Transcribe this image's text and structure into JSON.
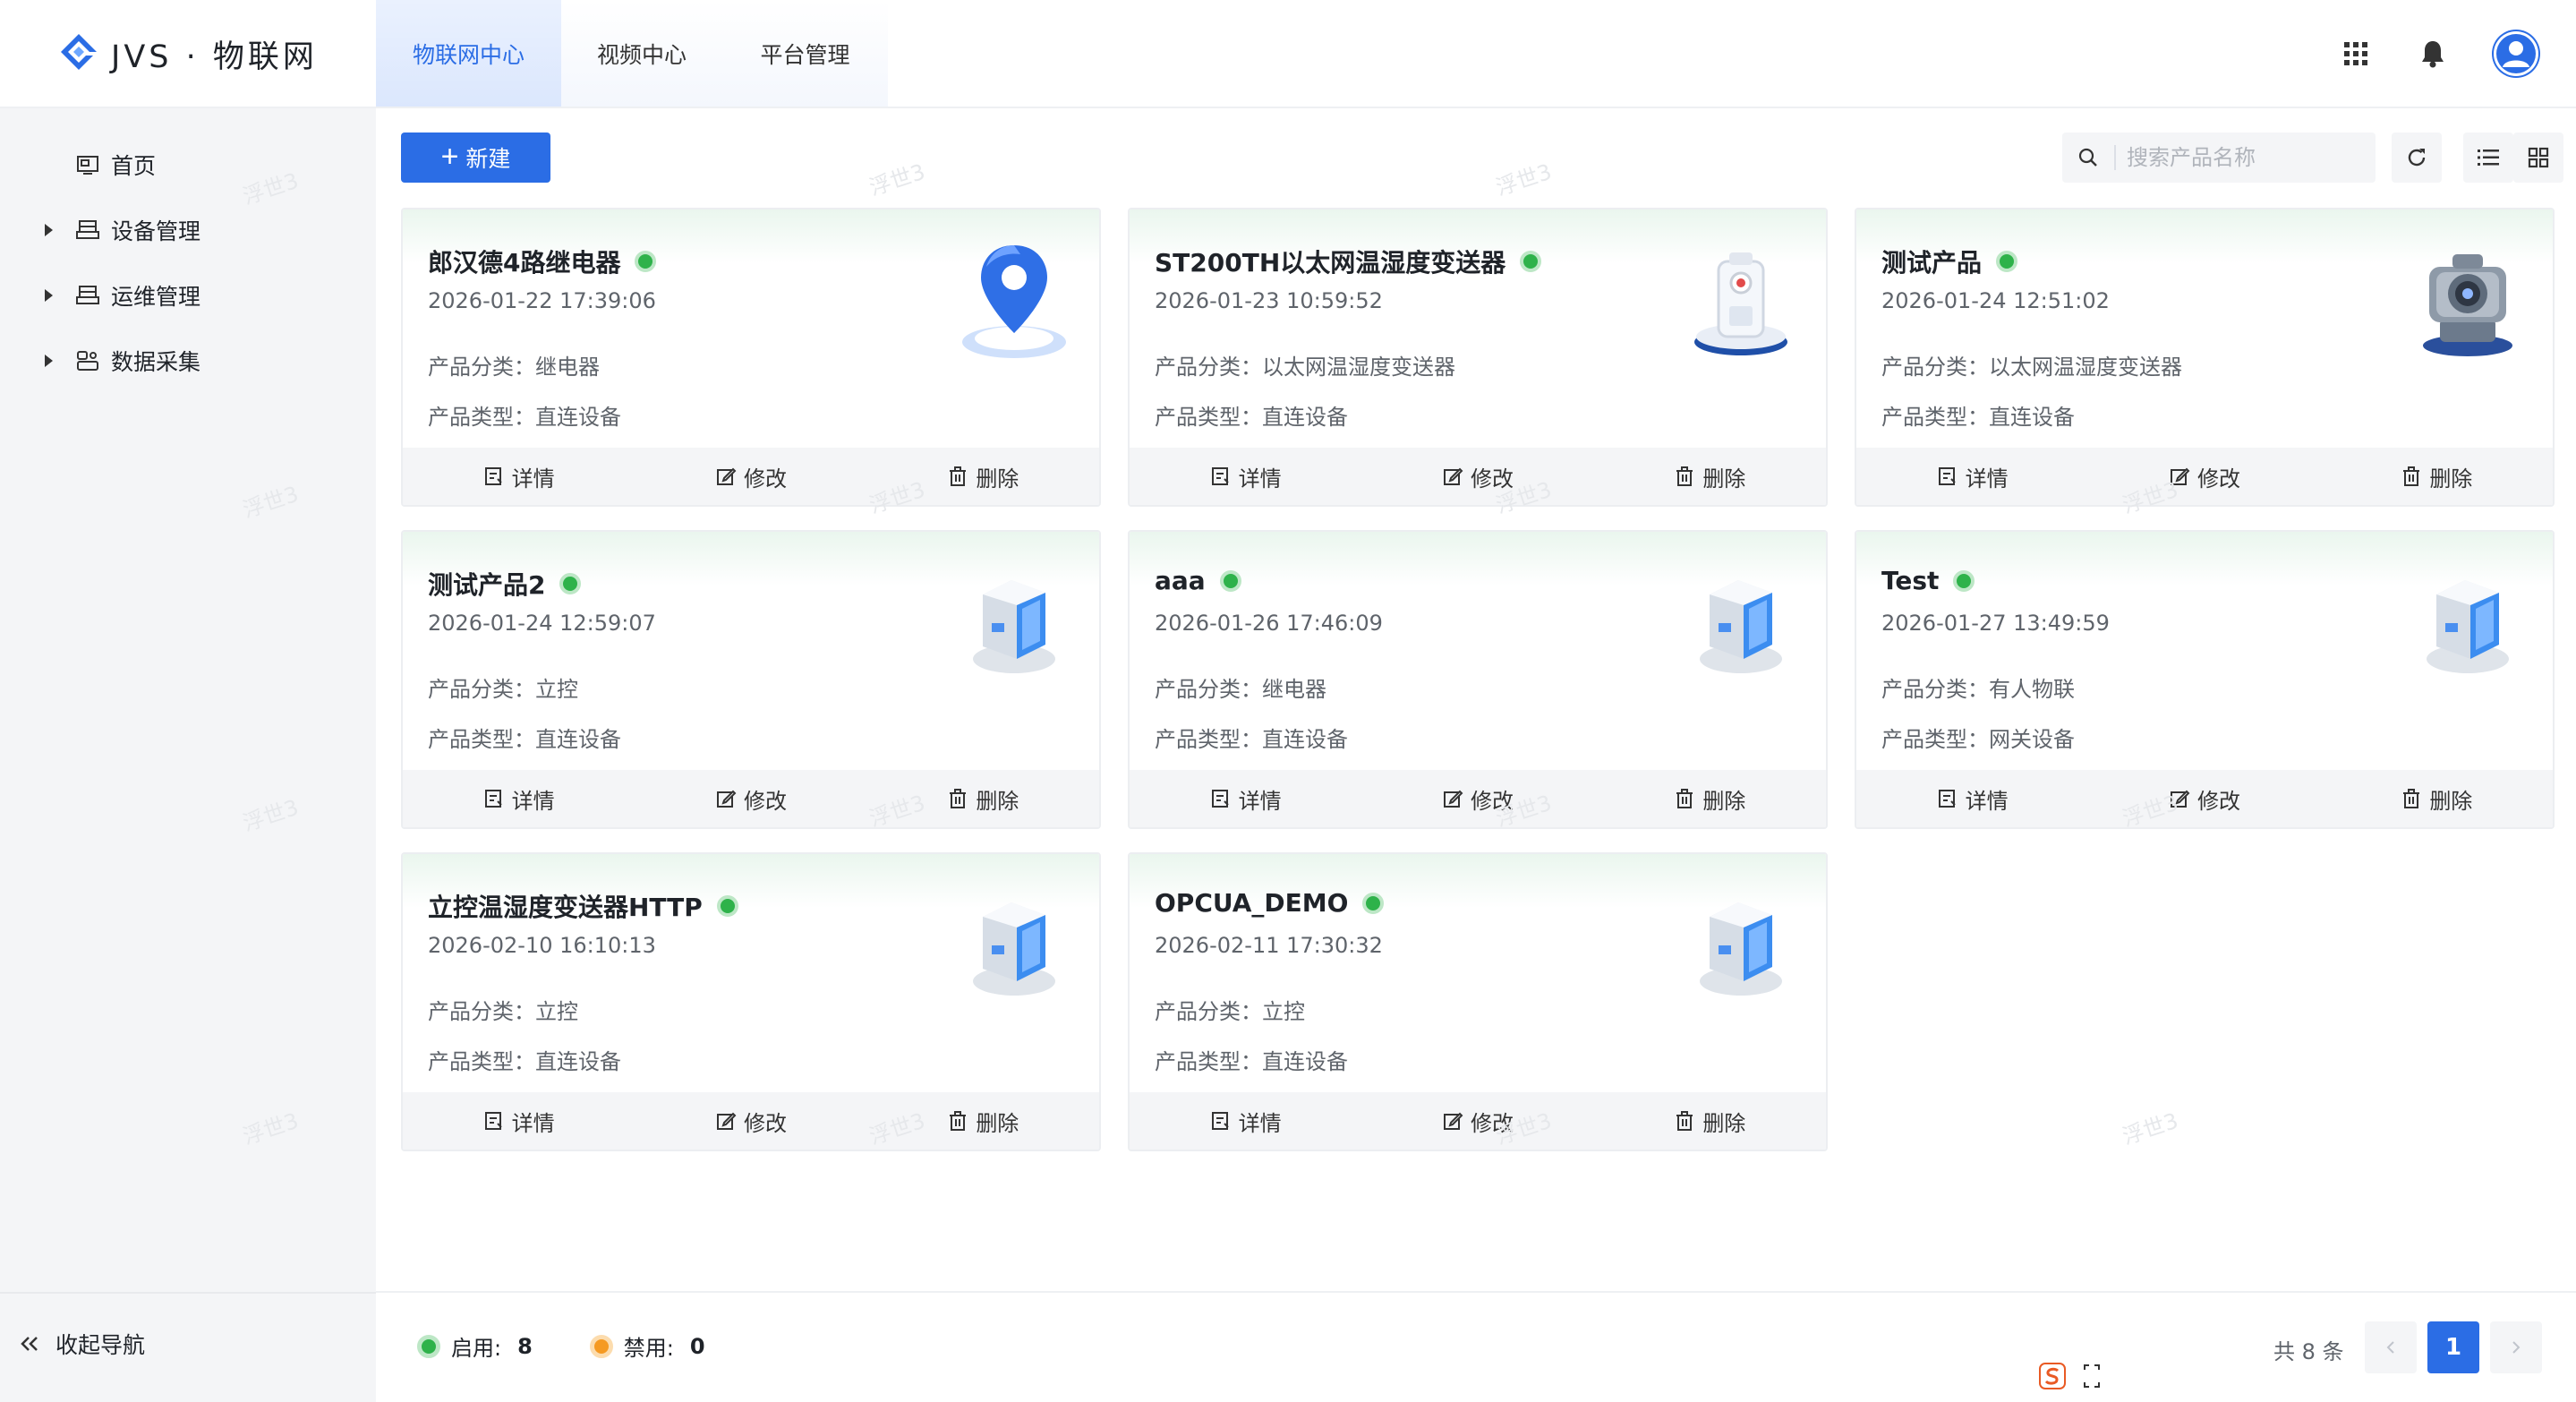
{
  "header": {
    "logo_text": "JVS · 物联网",
    "tabs": [
      {
        "label": "物联网中心",
        "active": true
      },
      {
        "label": "视频中心",
        "active": false
      },
      {
        "label": "平台管理",
        "active": false
      }
    ],
    "icons": [
      "apps-grid-icon",
      "bell-icon",
      "user-avatar-icon"
    ]
  },
  "sidebar": {
    "items": [
      {
        "label": "首页",
        "icon": "home-icon",
        "expandable": false
      },
      {
        "label": "设备管理",
        "icon": "device-icon",
        "expandable": true
      },
      {
        "label": "运维管理",
        "icon": "maintenance-icon",
        "expandable": true
      },
      {
        "label": "数据采集",
        "icon": "data-collection-icon",
        "expandable": true
      }
    ],
    "collapse_label": "收起导航"
  },
  "toolbar": {
    "new_label": "新建",
    "search_placeholder": "搜索产品名称"
  },
  "actions": {
    "detail": "详情",
    "edit": "修改",
    "delete": "删除"
  },
  "labels": {
    "category_prefix": "产品分类：",
    "type_prefix": "产品类型："
  },
  "products": [
    {
      "name": "郎汉德4路继电器",
      "time": "2026-01-22 17:39:06",
      "category": "继电器",
      "type": "直连设备",
      "image": "location-pin-icon",
      "enabled": true
    },
    {
      "name": "ST200TH以太网温湿度变送器",
      "time": "2026-01-23 10:59:52",
      "category": "以太网温湿度变送器",
      "type": "直连设备",
      "image": "sensor-device-icon",
      "enabled": true
    },
    {
      "name": "测试产品",
      "time": "2026-01-24 12:51:02",
      "category": "以太网温湿度变送器",
      "type": "直连设备",
      "image": "camera-device-icon",
      "enabled": true
    },
    {
      "name": "测试产品2",
      "time": "2026-01-24 12:59:07",
      "category": "立控",
      "type": "直连设备",
      "image": "box-device-icon",
      "enabled": true
    },
    {
      "name": "aaa",
      "time": "2026-01-26 17:46:09",
      "category": "继电器",
      "type": "直连设备",
      "image": "box-device-icon",
      "enabled": true
    },
    {
      "name": "Test",
      "time": "2026-01-27 13:49:59",
      "category": "有人物联",
      "type": "网关设备",
      "image": "box-device-icon",
      "enabled": true
    },
    {
      "name": "立控温湿度变送器HTTP",
      "time": "2026-02-10 16:10:13",
      "category": "立控",
      "type": "直连设备",
      "image": "box-device-icon",
      "enabled": true
    },
    {
      "name": "OPCUA_DEMO",
      "time": "2026-02-11 17:30:32",
      "category": "立控",
      "type": "直连设备",
      "image": "box-device-icon",
      "enabled": true
    }
  ],
  "footer": {
    "enabled_label": "启用:",
    "enabled_count": "8",
    "disabled_label": "禁用:",
    "disabled_count": "0",
    "total": "共 8 条",
    "current_page": "1"
  },
  "watermark": "浮世3",
  "colors": {
    "primary": "#2b6de5",
    "enabled": "#2eb24a",
    "disabled": "#f59a23",
    "sidebar_bg": "#f4f5f7"
  }
}
